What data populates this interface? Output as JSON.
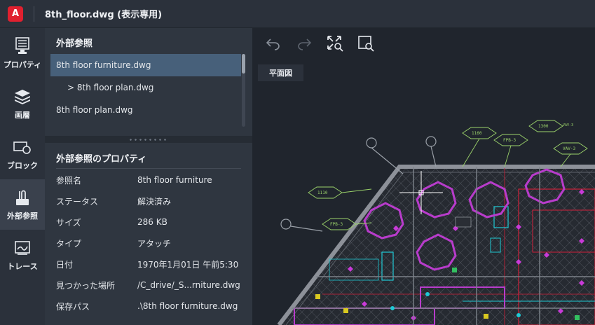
{
  "app": {
    "logo_letter": "A",
    "title": "8th_floor.dwg (表示専用)",
    "brand_color": "#e0202f"
  },
  "rail": {
    "items": [
      {
        "label": "プロパティ",
        "icon": "properties-icon"
      },
      {
        "label": "画層",
        "icon": "layers-icon"
      },
      {
        "label": "ブロック",
        "icon": "block-icon"
      },
      {
        "label": "外部参照",
        "icon": "xref-paperclip-icon",
        "active": true
      },
      {
        "label": "トレース",
        "icon": "trace-icon"
      }
    ]
  },
  "xrefs": {
    "heading": "外部参照",
    "items": [
      {
        "label": "8th floor furniture.dwg",
        "selected": true
      },
      {
        "label": "> 8th floor plan.dwg",
        "child": true
      },
      {
        "label": "8th floor plan.dwg"
      }
    ]
  },
  "properties": {
    "heading": "外部参照のプロパティ",
    "rows": [
      {
        "key": "参照名",
        "value": "8th floor furniture"
      },
      {
        "key": "ステータス",
        "value": "解決済み"
      },
      {
        "key": "サイズ",
        "value": "286 KB"
      },
      {
        "key": "タイプ",
        "value": "アタッチ"
      },
      {
        "key": "日付",
        "value": "1970年1月01日 午前5:30"
      },
      {
        "key": "見つかった場所",
        "value": "/C_drive/_S...rniture.dwg"
      },
      {
        "key": "保存パス",
        "value": ".\\8th floor furniture.dwg"
      }
    ]
  },
  "toolbar": {
    "icons": [
      "undo-icon",
      "redo-icon",
      "zoom-extents-icon",
      "zoom-window-icon"
    ]
  },
  "view": {
    "tab_label": "平面図"
  },
  "drawing": {
    "tags": [
      "1160",
      "1300",
      "FPB-3",
      "VAV-3",
      "1110",
      "FPB-3",
      "VAV-3"
    ],
    "colors": {
      "grid": "#7d828a",
      "tags": "#9bd26a",
      "furniture": "#c040d0",
      "cyan": "#1fc9d4",
      "red": "#e0203a"
    }
  }
}
